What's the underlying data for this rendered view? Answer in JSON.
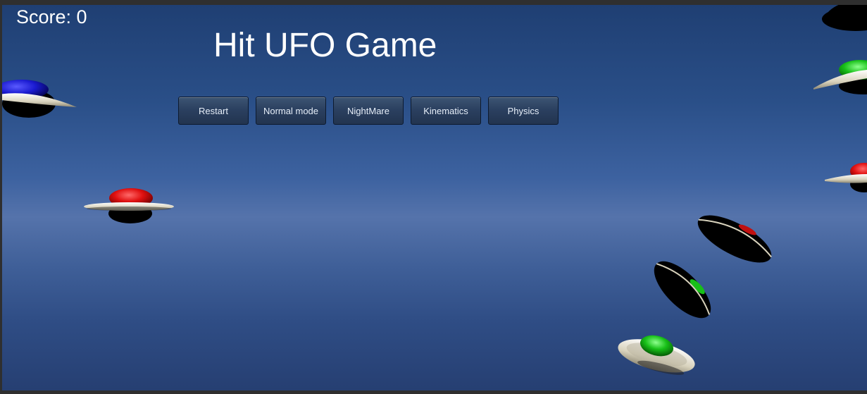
{
  "hud": {
    "score_label": "Score: 0"
  },
  "title": "Hit UFO Game",
  "buttons": [
    {
      "label": "Restart"
    },
    {
      "label": "Normal mode"
    },
    {
      "label": "NightMare"
    },
    {
      "label": "Kinematics"
    },
    {
      "label": "Physics"
    }
  ],
  "colors": {
    "sky_top": "#1f3f73",
    "sky_horizon": "#5573ab",
    "ufo_red": "#e01010",
    "ufo_green": "#18c018",
    "ufo_blue": "#1a1ad0",
    "ufo_disc": "#e8e4d4"
  },
  "ufos": [
    {
      "name": "ufo-blue",
      "color": "blue"
    },
    {
      "name": "ufo-red",
      "color": "red"
    },
    {
      "name": "ufo-green-top-right",
      "color": "green"
    },
    {
      "name": "ufo-top-right-edge",
      "color": "black"
    },
    {
      "name": "ufo-red-right-edge",
      "color": "red"
    },
    {
      "name": "ufo-tilted-red",
      "color": "red"
    },
    {
      "name": "ufo-tilted-green",
      "color": "green"
    },
    {
      "name": "ufo-green-bottom",
      "color": "green"
    }
  ]
}
